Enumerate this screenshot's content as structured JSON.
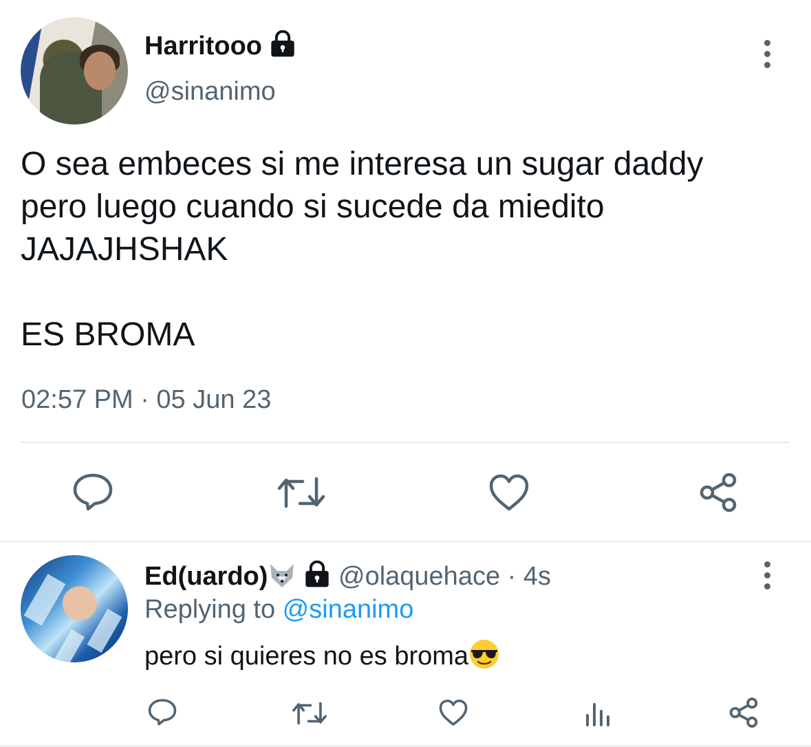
{
  "tweet": {
    "author_name": "Harritooo",
    "author_handle": "@sinanimo",
    "text_line1": "O sea embeces si me interesa un sugar daddy",
    "text_line2": "pero luego cuando si sucede da miedito",
    "text_line3": "JAJAJHSHAK",
    "text_line4": "ES BROMA",
    "timestamp": "02:57 PM · 05 Jun 23",
    "actions": [
      "reply-icon",
      "retweet-icon",
      "like-icon",
      "share-icon"
    ]
  },
  "reply": {
    "author_name": "Ed(uardo)",
    "author_handle": "@olaquehace",
    "age": "· 4s",
    "replying_prefix": "Replying to ",
    "replying_to": "@sinanimo",
    "text": "pero si quieres no es broma",
    "actions": [
      "reply-icon",
      "retweet-icon",
      "like-icon",
      "analytics-icon",
      "share-icon"
    ]
  },
  "colors": {
    "text": "#0f1419",
    "secondary": "#536471",
    "link": "#1d9bf0",
    "divider": "#e6e9ec"
  }
}
